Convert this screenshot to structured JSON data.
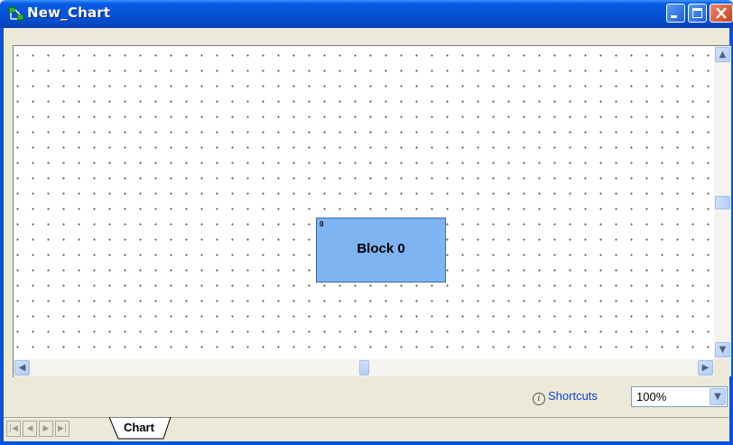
{
  "window": {
    "title": "New_Chart",
    "controls": [
      "minimize",
      "maximize",
      "close"
    ]
  },
  "canvas": {
    "blocks": [
      {
        "index": "0",
        "label": "Block 0",
        "fill": "#7fb4f2"
      }
    ]
  },
  "status": {
    "shortcuts_label": "Shortcuts",
    "zoom_value": "100%"
  },
  "tabs": [
    {
      "label": "Chart",
      "active": true
    }
  ],
  "icons": {
    "app": "chart-app-icon",
    "info": "info-icon",
    "nav": [
      "first-sheet-icon",
      "prev-sheet-icon",
      "next-sheet-icon",
      "last-sheet-icon"
    ]
  },
  "colors": {
    "titlebar": "#0653d8",
    "block": "#7fb4f2",
    "link": "#0b3fd6"
  }
}
